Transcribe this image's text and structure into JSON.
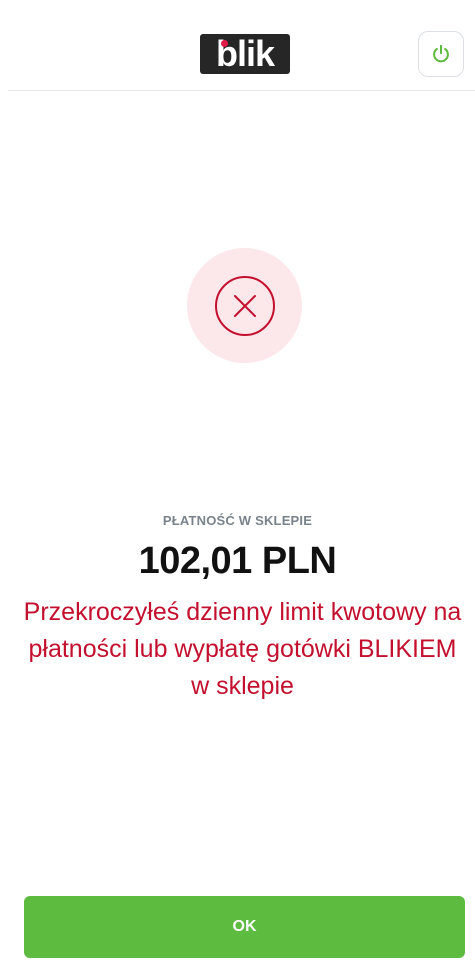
{
  "header": {
    "logo_text": "blik",
    "logo_icon": "blik-logo",
    "power_icon": "power-icon",
    "accent_color": "#5dbb3f"
  },
  "status": {
    "icon": "close-circle-icon",
    "circle_bg": "#fce7ea",
    "icon_color": "#c4102f"
  },
  "payment": {
    "label": "PŁATNOŚĆ W SKLEPIE",
    "amount": "102,01 PLN",
    "error_message": "Przekroczyłeś dzienny limit kwotowy na płatności lub wypłatę gotówki BLIKIEM w sklepie"
  },
  "actions": {
    "ok_label": "OK",
    "ok_color": "#5dbb3f"
  }
}
